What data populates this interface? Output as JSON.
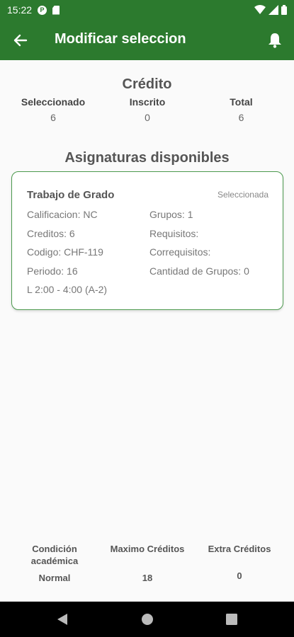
{
  "status_bar": {
    "time": "15:22",
    "icons": [
      "p-circle-icon",
      "sd-card-icon",
      "wifi-icon",
      "signal-icon",
      "battery-icon"
    ]
  },
  "app_bar": {
    "title": "Modificar seleccion",
    "back_icon": "arrow-left-icon",
    "notification_icon": "bell-icon"
  },
  "credits": {
    "title": "Crédito",
    "columns": [
      {
        "label": "Seleccionado",
        "value": "6"
      },
      {
        "label": "Inscrito",
        "value": "0"
      },
      {
        "label": "Total",
        "value": "6"
      }
    ]
  },
  "subjects": {
    "title": "Asignaturas disponibles",
    "items": [
      {
        "name": "Trabajo de Grado",
        "status": "Seleccionada",
        "calificacion": "Calificacion: NC",
        "creditos": "Creditos: 6",
        "codigo": "Codigo: CHF-119",
        "periodo": "Periodo: 16",
        "horario": "L 2:00 - 4:00 (A-2)",
        "grupos": "Grupos: 1",
        "requisitos": "Requisitos:",
        "correquisitos": "Correquisitos:",
        "cantidad_grupos": "Cantidad de Grupos: 0"
      }
    ]
  },
  "footer": {
    "condicion": {
      "label": "Condición académica",
      "value": "Normal"
    },
    "maximo": {
      "label": "Maximo Créditos",
      "value": "18"
    },
    "extra": {
      "label": "Extra Créditos",
      "value": "0"
    }
  },
  "nav_bar": {
    "icons": [
      "back-triangle-icon",
      "home-circle-icon",
      "recents-square-icon"
    ]
  },
  "colors": {
    "primary": "#2c7a2e",
    "card_border": "#4c9a4e",
    "background": "#fafafa"
  }
}
